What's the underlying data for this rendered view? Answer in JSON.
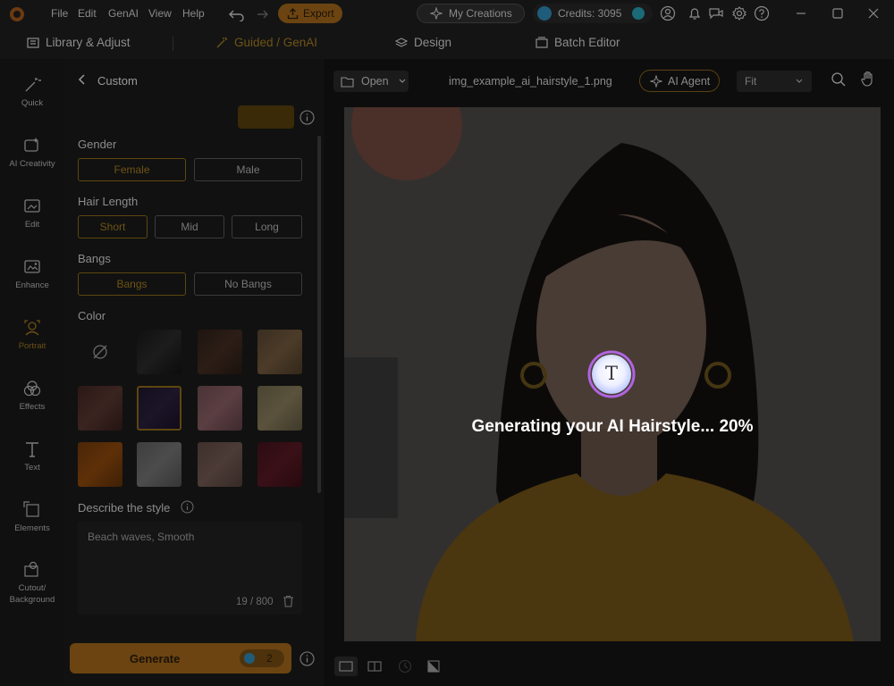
{
  "menu": [
    "File",
    "Edit",
    "GenAI",
    "View",
    "Help"
  ],
  "export_label": "Export",
  "my_creations_label": "My Creations",
  "credits_label": "Credits: 3095",
  "tabs": [
    {
      "label": "Library & Adjust",
      "icon": "library-icon"
    },
    {
      "label": "Guided / GenAI",
      "icon": "magic-wand-icon",
      "active": true
    },
    {
      "label": "Design",
      "icon": "layers-icon"
    },
    {
      "label": "Batch Editor",
      "icon": "batch-icon"
    }
  ],
  "rail": [
    {
      "label": "Quick",
      "icon": "quick-wand-icon"
    },
    {
      "label": "AI Creativity",
      "icon": "ai-creativity-icon"
    },
    {
      "label": "Edit",
      "icon": "edit-image-icon"
    },
    {
      "label": "Enhance",
      "icon": "enhance-icon"
    },
    {
      "label": "Portrait",
      "icon": "portrait-icon",
      "active": true
    },
    {
      "label": "Effects",
      "icon": "effects-icon"
    },
    {
      "label": "Text",
      "icon": "text-icon"
    },
    {
      "label": "Elements",
      "icon": "elements-icon"
    },
    {
      "label": "Cutout/ Background",
      "icon": "cutout-icon"
    }
  ],
  "panel": {
    "back_label": "Custom",
    "gender": {
      "label": "Gender",
      "options": [
        "Female",
        "Male"
      ],
      "selected": "Female"
    },
    "hair_length": {
      "label": "Hair Length",
      "options": [
        "Short",
        "Mid",
        "Long"
      ],
      "selected": "Short"
    },
    "bangs": {
      "label": "Bangs",
      "options": [
        "Bangs",
        "No Bangs"
      ],
      "selected": "Bangs"
    },
    "color": {
      "label": "Color"
    },
    "describe": {
      "label": "Describe the style",
      "value": "Beach waves, Smooth",
      "counter": "19 / 800"
    },
    "generate_label": "Generate",
    "generate_cost": "2"
  },
  "canvas": {
    "open_label": "Open",
    "filename": "img_example_ai_hairstyle_1.png",
    "ai_agent_label": "AI Agent",
    "zoom_value": "Fit",
    "progress_text": "Generating your AI Hairstyle... 20%",
    "progress_percent": 20,
    "loader_glyph": "T"
  },
  "colors": {
    "accent": "#6b4f12",
    "overlay": "rgba(0,0,0,0.62)"
  }
}
